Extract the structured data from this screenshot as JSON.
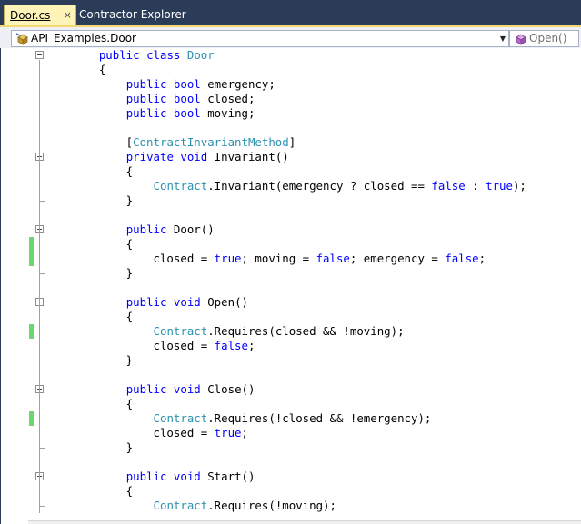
{
  "tabs": [
    {
      "label": "Door.cs",
      "active": true,
      "close_glyph": "×"
    },
    {
      "label": "Contractor Explorer",
      "active": false
    }
  ],
  "navbar": {
    "type_selector": {
      "value": "API_Examples.Door",
      "icon": "class-icon"
    },
    "member_selector": {
      "value": "Open()",
      "icon": "method-icon"
    }
  },
  "colors": {
    "keyword": "#0000ff",
    "type": "#2b91af",
    "text": "#000000",
    "changed_line": "#6ed66e",
    "chrome": "#2b3c59",
    "active_tab": "#fff4b8"
  },
  "code": {
    "lines": [
      [
        {
          "t": "    "
        },
        {
          "t": "public",
          "c": "kw"
        },
        {
          "t": " "
        },
        {
          "t": "class",
          "c": "kw"
        },
        {
          "t": " "
        },
        {
          "t": "Door",
          "c": "ty"
        }
      ],
      [
        {
          "t": "    {"
        }
      ],
      [
        {
          "t": "        "
        },
        {
          "t": "public",
          "c": "kw"
        },
        {
          "t": " "
        },
        {
          "t": "bool",
          "c": "kw"
        },
        {
          "t": " emergency;"
        }
      ],
      [
        {
          "t": "        "
        },
        {
          "t": "public",
          "c": "kw"
        },
        {
          "t": " "
        },
        {
          "t": "bool",
          "c": "kw"
        },
        {
          "t": " closed;"
        }
      ],
      [
        {
          "t": "        "
        },
        {
          "t": "public",
          "c": "kw"
        },
        {
          "t": " "
        },
        {
          "t": "bool",
          "c": "kw"
        },
        {
          "t": " moving;"
        }
      ],
      [
        {
          "t": ""
        }
      ],
      [
        {
          "t": "        ["
        },
        {
          "t": "ContractInvariantMethod",
          "c": "ty"
        },
        {
          "t": "]"
        }
      ],
      [
        {
          "t": "        "
        },
        {
          "t": "private",
          "c": "kw"
        },
        {
          "t": " "
        },
        {
          "t": "void",
          "c": "kw"
        },
        {
          "t": " Invariant()"
        }
      ],
      [
        {
          "t": "        {"
        }
      ],
      [
        {
          "t": "            "
        },
        {
          "t": "Contract",
          "c": "ty"
        },
        {
          "t": ".Invariant(emergency ? closed == "
        },
        {
          "t": "false",
          "c": "kw"
        },
        {
          "t": " : "
        },
        {
          "t": "true",
          "c": "kw"
        },
        {
          "t": ");"
        }
      ],
      [
        {
          "t": "        }"
        }
      ],
      [
        {
          "t": ""
        }
      ],
      [
        {
          "t": "        "
        },
        {
          "t": "public",
          "c": "kw"
        },
        {
          "t": " Door()"
        }
      ],
      [
        {
          "t": "        {"
        }
      ],
      [
        {
          "t": "            closed = "
        },
        {
          "t": "true",
          "c": "kw"
        },
        {
          "t": "; moving = "
        },
        {
          "t": "false",
          "c": "kw"
        },
        {
          "t": "; emergency = "
        },
        {
          "t": "false",
          "c": "kw"
        },
        {
          "t": ";"
        }
      ],
      [
        {
          "t": "        }"
        }
      ],
      [
        {
          "t": ""
        }
      ],
      [
        {
          "t": "        "
        },
        {
          "t": "public",
          "c": "kw"
        },
        {
          "t": " "
        },
        {
          "t": "void",
          "c": "kw"
        },
        {
          "t": " Open()"
        }
      ],
      [
        {
          "t": "        {"
        }
      ],
      [
        {
          "t": "            "
        },
        {
          "t": "Contract",
          "c": "ty"
        },
        {
          "t": ".Requires(closed && !moving);"
        }
      ],
      [
        {
          "t": "            closed = "
        },
        {
          "t": "false",
          "c": "kw"
        },
        {
          "t": ";"
        }
      ],
      [
        {
          "t": "        }"
        }
      ],
      [
        {
          "t": ""
        }
      ],
      [
        {
          "t": "        "
        },
        {
          "t": "public",
          "c": "kw"
        },
        {
          "t": " "
        },
        {
          "t": "void",
          "c": "kw"
        },
        {
          "t": " Close()"
        }
      ],
      [
        {
          "t": "        {"
        }
      ],
      [
        {
          "t": "            "
        },
        {
          "t": "Contract",
          "c": "ty"
        },
        {
          "t": ".Requires(!closed && !emergency);"
        }
      ],
      [
        {
          "t": "            closed = "
        },
        {
          "t": "true",
          "c": "kw"
        },
        {
          "t": ";"
        }
      ],
      [
        {
          "t": "        }"
        }
      ],
      [
        {
          "t": ""
        }
      ],
      [
        {
          "t": "        "
        },
        {
          "t": "public",
          "c": "kw"
        },
        {
          "t": " "
        },
        {
          "t": "void",
          "c": "kw"
        },
        {
          "t": " Start()"
        }
      ],
      [
        {
          "t": "        {"
        }
      ],
      [
        {
          "t": "            "
        },
        {
          "t": "Contract",
          "c": "ty"
        },
        {
          "t": ".Requires(!moving);"
        }
      ]
    ],
    "collapsible_lines": [
      0,
      7,
      12,
      17,
      23,
      29
    ],
    "changed_lines": [
      13,
      14,
      19,
      25
    ]
  }
}
